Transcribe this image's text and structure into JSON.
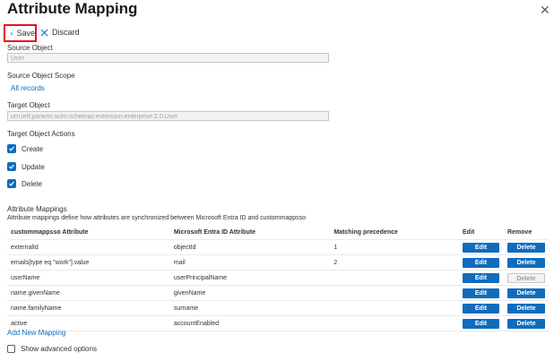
{
  "header": {
    "title": "Attribute Mapping",
    "more": "···",
    "close": "✕"
  },
  "toolbar": {
    "save_label": "Save",
    "discard_label": "Discard"
  },
  "source_object": {
    "label": "Source Object",
    "value": "User"
  },
  "source_scope": {
    "label": "Source Object Scope",
    "link": "All records"
  },
  "target_object": {
    "label": "Target Object",
    "value": "urn:ietf:params:scim:schemas:extension:enterprise:2.0:User"
  },
  "target_actions": {
    "label": "Target Object Actions",
    "items": [
      {
        "label": "Create",
        "checked": true
      },
      {
        "label": "Update",
        "checked": true
      },
      {
        "label": "Delete",
        "checked": true
      }
    ]
  },
  "mappings": {
    "heading": "Attribute Mappings",
    "description": "Attribute mappings define how attributes are synchronized between Microsoft Entra ID and custommappsso",
    "columns": [
      "custommappsso Attribute",
      "Microsoft Entra ID Attribute",
      "Matching precedence",
      "Edit",
      "Remove"
    ],
    "edit_label": "Edit",
    "delete_label": "Delete",
    "rows": [
      {
        "target": "externalId",
        "source": "objectId",
        "precedence": "1",
        "delete_enabled": true
      },
      {
        "target": "emails[type eq \"work\"].value",
        "source": "mail",
        "precedence": "2",
        "delete_enabled": true
      },
      {
        "target": "userName",
        "source": "userPrincipalName",
        "precedence": "",
        "delete_enabled": false
      },
      {
        "target": "name.givenName",
        "source": "givenName",
        "precedence": "",
        "delete_enabled": true
      },
      {
        "target": "name.familyName",
        "source": "surname",
        "precedence": "",
        "delete_enabled": true
      },
      {
        "target": "active",
        "source": "accountEnabled",
        "precedence": "",
        "delete_enabled": true
      }
    ],
    "add_link": "Add New Mapping"
  },
  "advanced": {
    "label": "Show advanced options",
    "checked": false
  },
  "colors": {
    "accent": "#0f6cbd",
    "highlight": "#e81123"
  }
}
